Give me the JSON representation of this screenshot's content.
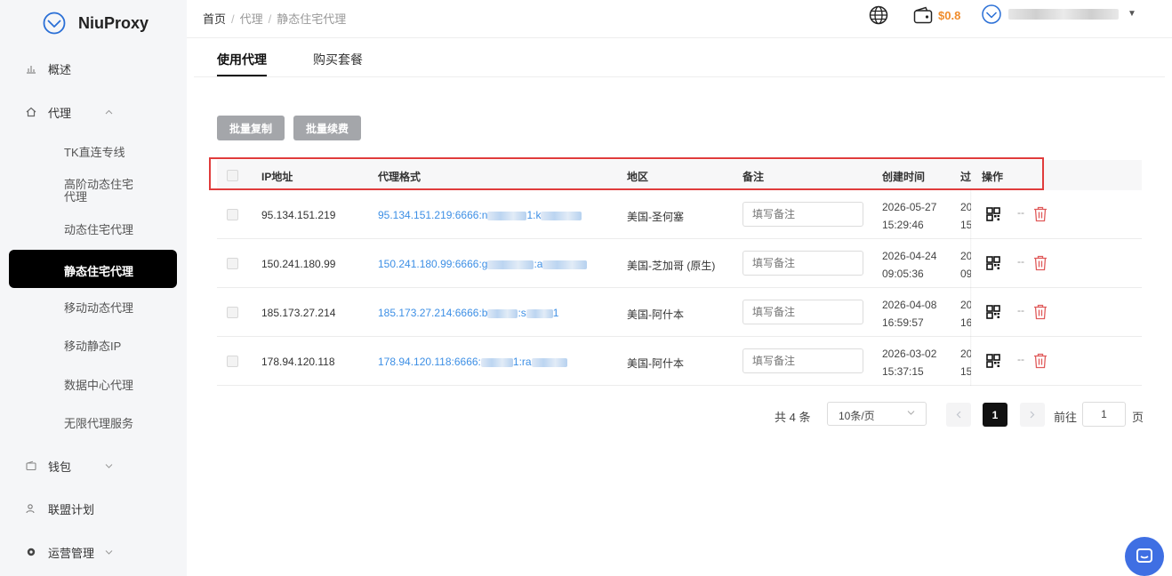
{
  "brand": {
    "name": "NiuProxy"
  },
  "sidebar": {
    "items": [
      {
        "label": "概述",
        "icon": "chart-icon"
      },
      {
        "label": "代理",
        "icon": "home-icon"
      },
      {
        "label": "钱包",
        "icon": "wallet-icon"
      },
      {
        "label": "联盟计划",
        "icon": "users-icon"
      },
      {
        "label": "运营管理",
        "icon": "gear-icon"
      }
    ],
    "proxy_sub": [
      "TK直连专线",
      "高阶动态住宅\n代理",
      "动态住宅代理",
      "静态住宅代理",
      "移动动态代理",
      "移动静态IP",
      "数据中心代理",
      "无限代理服务"
    ],
    "proxy_sub_line1": "高阶动态住宅",
    "proxy_sub_line2": "代理",
    "active": "静态住宅代理"
  },
  "header": {
    "breadcrumb": [
      "首页",
      "代理",
      "静态住宅代理"
    ],
    "balance": "$0.8"
  },
  "tabs": [
    "使用代理",
    "购买套餐"
  ],
  "actions": {
    "batch_copy": "批量复制",
    "batch_renew": "批量续费"
  },
  "table": {
    "headers": {
      "ip": "IP地址",
      "format": "代理格式",
      "region": "地区",
      "note": "备注",
      "created": "创建时间",
      "expire": "过期",
      "ops": "操作"
    },
    "note_placeholder": "填写备注",
    "rows": [
      {
        "ip": "95.134.151.219",
        "format_prefix": "95.134.151.219:6666:n",
        "format_mid": "1:k",
        "region": "美国-圣何塞",
        "created_date": "2026-05-27",
        "created_time": "15:29:46",
        "expire_date": "20",
        "expire_time": "15"
      },
      {
        "ip": "150.241.180.99",
        "format_prefix": "150.241.180.99:6666:g",
        "format_mid": ":a",
        "region": "美国-芝加哥 (原生)",
        "created_date": "2026-04-24",
        "created_time": "09:05:36",
        "expire_date": "20",
        "expire_time": "09"
      },
      {
        "ip": "185.173.27.214",
        "format_prefix": "185.173.27.214:6666:b",
        "format_mid": ":s",
        "region": "美国-阿什本",
        "created_date": "2026-04-08",
        "created_time": "16:59:57",
        "expire_date": "20",
        "expire_time": "16"
      },
      {
        "ip": "178.94.120.118",
        "format_prefix": "178.94.120.118:6666:",
        "format_mid": "1:ra",
        "region": "美国-阿什本",
        "created_date": "2026-03-02",
        "created_time": "15:37:15",
        "expire_date": "20",
        "expire_time": "15"
      }
    ],
    "last_chars": [
      "",
      "",
      "1",
      ""
    ],
    "ops_separator": "--"
  },
  "pagination": {
    "total": "共 4 条",
    "page_size": "10条/页",
    "current": "1",
    "goto_label": "前往",
    "goto_value": "1",
    "page_suffix": "页"
  },
  "colors": {
    "accent": "#000000",
    "link": "#3d8fe5",
    "balance": "#f08c2b",
    "danger": "#e03c3c",
    "chat": "#3f6fe3"
  }
}
